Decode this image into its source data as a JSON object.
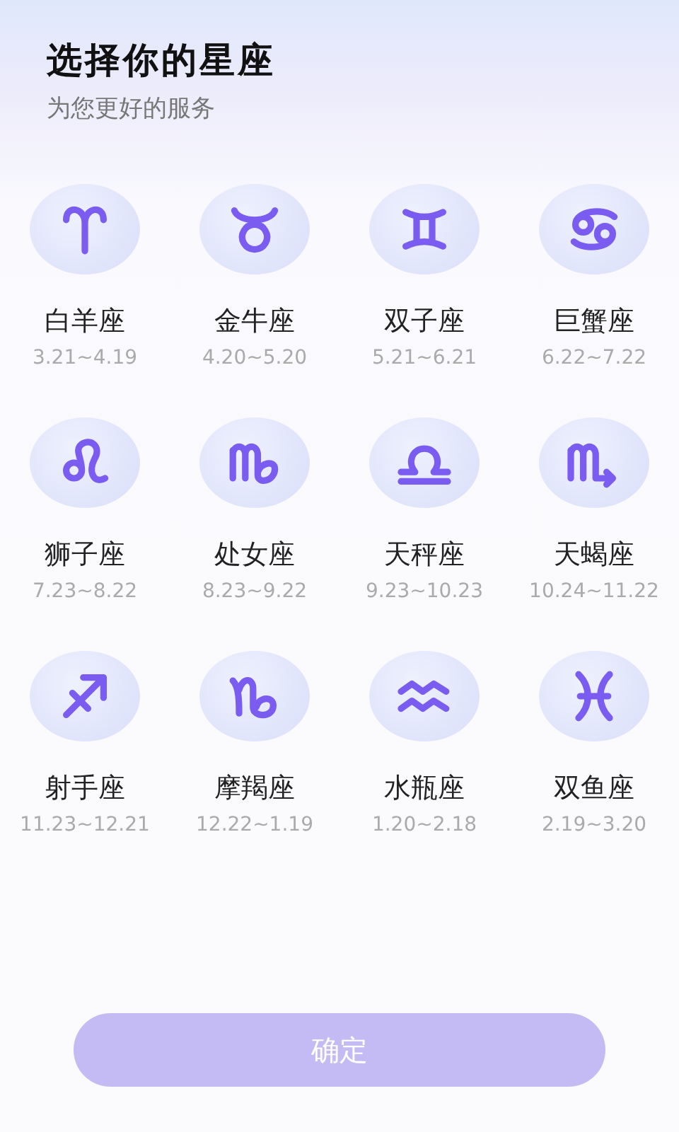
{
  "header": {
    "title": "选择你的星座",
    "subtitle": "为您更好的服务"
  },
  "signs": [
    {
      "name": "白羊座",
      "dates": "3.21~4.19",
      "selected": false
    },
    {
      "name": "金牛座",
      "dates": "4.20~5.20",
      "selected": false
    },
    {
      "name": "双子座",
      "dates": "5.21~6.21",
      "selected": false
    },
    {
      "name": "巨蟹座",
      "dates": "6.22~7.22",
      "selected": false
    },
    {
      "name": "狮子座",
      "dates": "7.23~8.22",
      "selected": false
    },
    {
      "name": "处女座",
      "dates": "8.23~9.22",
      "selected": false
    },
    {
      "name": "天秤座",
      "dates": "9.23~10.23",
      "selected": false
    },
    {
      "name": "天蝎座",
      "dates": "10.24~11.22",
      "selected": false
    },
    {
      "name": "射手座",
      "dates": "11.23~12.21",
      "selected": false
    },
    {
      "name": "摩羯座",
      "dates": "12.22~1.19",
      "selected": false
    },
    {
      "name": "水瓶座",
      "dates": "1.20~2.18",
      "selected": false
    },
    {
      "name": "双鱼座",
      "dates": "2.19~3.20",
      "selected": false
    }
  ],
  "confirm_button": {
    "label": "确定",
    "disabled": true
  }
}
